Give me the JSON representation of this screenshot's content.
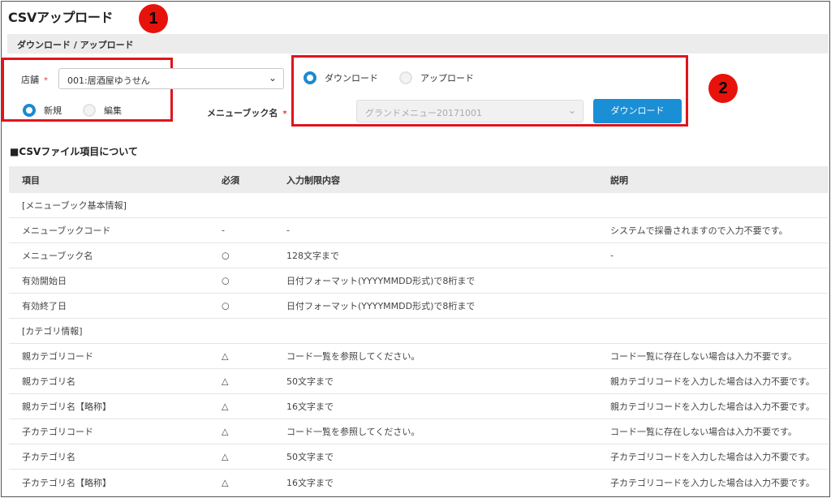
{
  "page": {
    "title": "CSVアップロード",
    "breadcrumb": "ダウンロード / アップロード"
  },
  "markers": [
    "1",
    "2"
  ],
  "store": {
    "label": "店舗",
    "required_mark": "*",
    "selected": "001:居酒屋ゆうせん"
  },
  "mode": {
    "options": [
      "新規",
      "編集"
    ],
    "selected": "新規"
  },
  "menu_book": {
    "label": "メニューブック名",
    "required_mark": "*",
    "selected": "グランドメニュー20171001",
    "disabled": true
  },
  "transfer": {
    "options": [
      "ダウンロード",
      "アップロード"
    ],
    "selected": "ダウンロード"
  },
  "download_button": "ダウンロード",
  "section_title": "■CSVファイル項目について",
  "table": {
    "headers": [
      "項目",
      "必須",
      "入力制限内容",
      "説明"
    ],
    "rows": [
      [
        "[メニューブック基本情報]",
        "",
        "",
        ""
      ],
      [
        "メニューブックコード",
        "-",
        "-",
        "システムで採番されますので入力不要です。"
      ],
      [
        "メニューブック名",
        "○",
        "128文字まで",
        "-"
      ],
      [
        "有効開始日",
        "○",
        "日付フォーマット(YYYYMMDD形式)で8桁まで",
        ""
      ],
      [
        "有効終了日",
        "○",
        "日付フォーマット(YYYYMMDD形式)で8桁まで",
        ""
      ],
      [
        "[カテゴリ情報]",
        "",
        "",
        ""
      ],
      [
        "親カテゴリコード",
        "△",
        "コード一覧を参照してください。",
        "コード一覧に存在しない場合は入力不要です。"
      ],
      [
        "親カテゴリ名",
        "△",
        "50文字まで",
        "親カテゴリコードを入力した場合は入力不要です。"
      ],
      [
        "親カテゴリ名【略称】",
        "△",
        "16文字まで",
        "親カテゴリコードを入力した場合は入力不要です。"
      ],
      [
        "子カテゴリコード",
        "△",
        "コード一覧を参照してください。",
        "コード一覧に存在しない場合は入力不要です。"
      ],
      [
        "子カテゴリ名",
        "△",
        "50文字まで",
        "子カテゴリコードを入力した場合は入力不要です。"
      ],
      [
        "子カテゴリ名【略称】",
        "△",
        "16文字まで",
        "子カテゴリコードを入力した場合は入力不要です。"
      ]
    ]
  },
  "icons": {
    "dropdown": "chevron-down-icon"
  },
  "colors": {
    "accent": "#1b8fd6",
    "annotation": "#e0141c",
    "header_bg": "#ececec"
  }
}
